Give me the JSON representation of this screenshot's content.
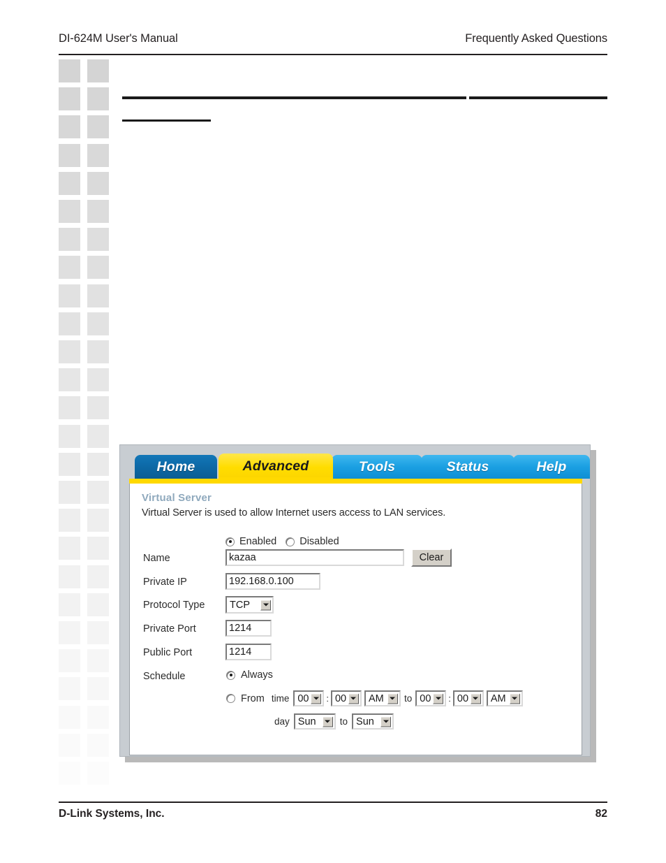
{
  "page": {
    "header_left": "DI-624M User's Manual",
    "header_right": "Frequently Asked Questions",
    "footer_left": "D-Link Systems, Inc.",
    "footer_page_number": "82"
  },
  "decoration": {
    "sidebar_block_columns": 2,
    "sidebar_block_rows": 26,
    "block_color_top": "#d4d4d4",
    "block_color_bottom": "#fcfcfc",
    "redaction_color": "#1a1a1a"
  },
  "router_ui": {
    "tabs": [
      {
        "label": "Home",
        "state": "inactive",
        "color": "#0d6aa8"
      },
      {
        "label": "Advanced",
        "state": "active",
        "color": "#ffdd00"
      },
      {
        "label": "Tools",
        "state": "inactive",
        "color": "#1ba0e2"
      },
      {
        "label": "Status",
        "state": "inactive",
        "color": "#1ba0e2"
      },
      {
        "label": "Help",
        "state": "inactive",
        "color": "#1ba0e2"
      }
    ],
    "accent_color": "#ffd900",
    "section": {
      "title": "Virtual Server",
      "title_color": "#8fa9bd",
      "description": "Virtual Server is used to allow Internet users access to LAN services."
    },
    "enable_radios": {
      "enabled_label": "Enabled",
      "disabled_label": "Disabled",
      "selected": "Enabled"
    },
    "fields": {
      "name": {
        "label": "Name",
        "value": "kazaa",
        "clear_button": "Clear"
      },
      "private_ip": {
        "label": "Private IP",
        "value": "192.168.0.100"
      },
      "protocol_type": {
        "label": "Protocol Type",
        "value": "TCP"
      },
      "private_port": {
        "label": "Private Port",
        "value": "1214"
      },
      "public_port": {
        "label": "Public Port",
        "value": "1214"
      }
    },
    "schedule": {
      "label": "Schedule",
      "always_label": "Always",
      "from_label": "From",
      "selected": "Always",
      "time_label": "time",
      "day_label": "day",
      "to_label": "to",
      "colon": ":",
      "start_hour": "00",
      "start_minute": "00",
      "start_meridiem": "AM",
      "end_hour": "00",
      "end_minute": "00",
      "end_meridiem": "AM",
      "start_day": "Sun",
      "end_day": "Sun"
    }
  }
}
